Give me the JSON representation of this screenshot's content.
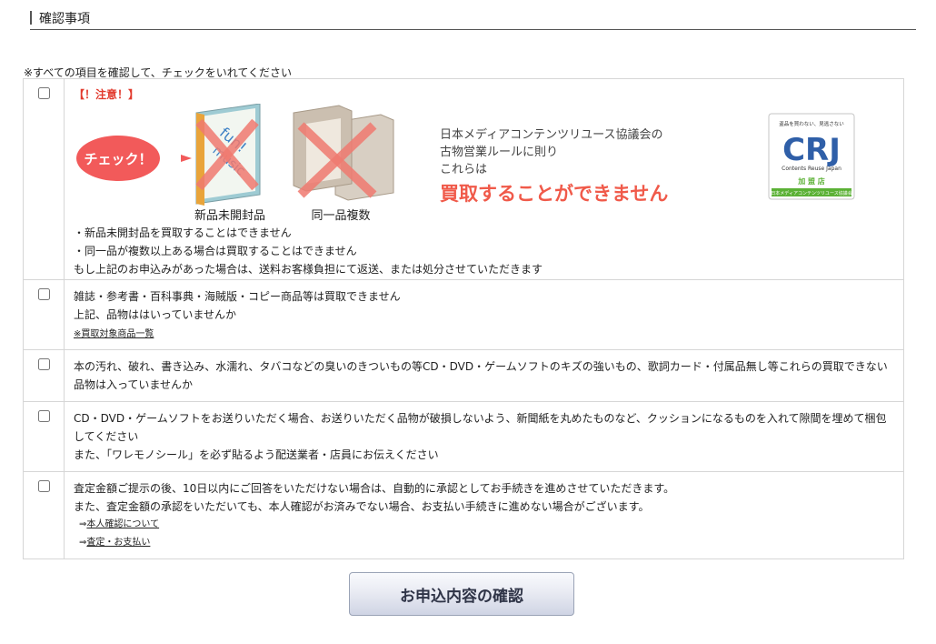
{
  "section": {
    "title": "確認事項"
  },
  "instruction": "※すべての項目を確認して、チェックをいれてください",
  "items": [
    {
      "warning": "【！注意！】",
      "illustration": {
        "check_badge": "チェック！",
        "music_label_1": "fun!",
        "music_label_2": "music",
        "label_new": "新品未開封品",
        "label_dup": "同一品複数",
        "msg_line1": "日本メディアコンテンツリユース協議会の",
        "msg_line2": "古物営業ルールに則り",
        "msg_line3": "これらは",
        "msg_big": "買取することができません",
        "crj_top": "盗品を買わない、見逃さない",
        "crj_letters": "CRJ",
        "crj_sub": "Contents Reuse Japan",
        "crj_member": "加 盟 店",
        "crj_bottom": "日本メディアコンテンツリユース協議会"
      },
      "lines": [
        "・新品未開封品を買取することはできません",
        "・同一品が複数以上ある場合は買取することはできません",
        "もし上記のお申込みがあった場合は、送料お客様負担にて返送、または処分させていただきます"
      ]
    },
    {
      "lines": [
        "雑誌・参考書・百科事典・海賊版・コピー商品等は買取できません",
        "上記、品物ははいっていませんか"
      ],
      "link": "※買取対象商品一覧"
    },
    {
      "lines": [
        "本の汚れ、破れ、書き込み、水濡れ、タバコなどの臭いのきついもの等CD・DVD・ゲームソフトのキズの強いもの、歌詞カード・付属品無し等これらの買取できない品物は入っていませんか"
      ]
    },
    {
      "lines": [
        "CD・DVD・ゲームソフトをお送りいただく場合、お送りいただく品物が破損しないよう、新聞紙を丸めたものなど、クッションになるものを入れて隙間を埋めて梱包してください",
        "また、「ワレモノシール」を必ず貼るよう配送業者・店員にお伝えください"
      ]
    },
    {
      "lines": [
        "査定金額ご提示の後、10日以内にご回答をいただけない場合は、自動的に承認としてお手続きを進めさせていただきます。",
        "また、査定金額の承認をいただいても、本人確認がお済みでない場合、お支払い手続きに進めない場合がございます。"
      ],
      "links": [
        {
          "arrow": "⇒",
          "label": "本人確認について"
        },
        {
          "arrow": "⇒",
          "label": "査定・お支払い"
        }
      ]
    }
  ],
  "submit_label": "お申込内容の確認",
  "colors": {
    "warning": "#e23b2e",
    "badge": "#f25a5a",
    "crj_green": "#5bb135",
    "crj_blue": "#2f5fa8"
  }
}
